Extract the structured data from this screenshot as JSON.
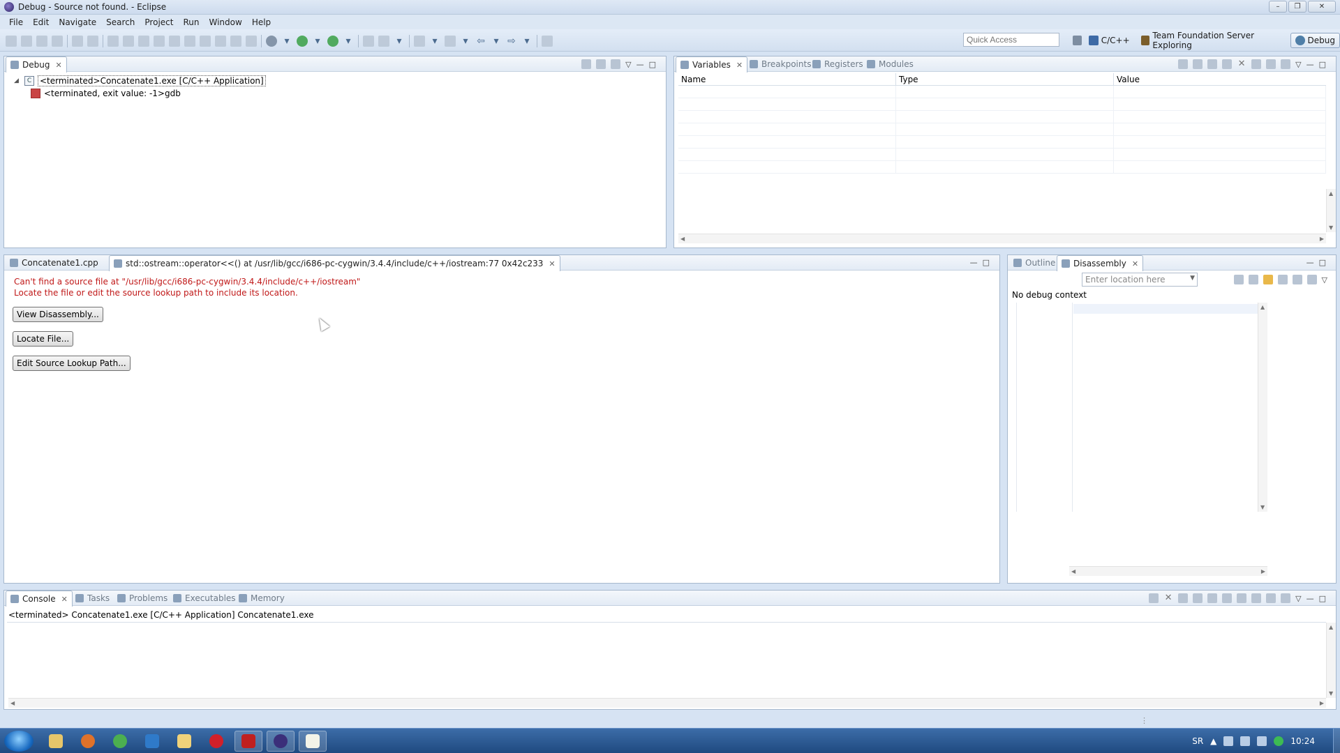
{
  "window": {
    "title": "Debug - Source not found. - Eclipse"
  },
  "menu": [
    "File",
    "Edit",
    "Navigate",
    "Search",
    "Project",
    "Run",
    "Window",
    "Help"
  ],
  "toolbar": {
    "quick_access_placeholder": "Quick Access"
  },
  "perspectives": [
    {
      "label": "C/C++",
      "icon": "cpp-perspective-icon"
    },
    {
      "label": "Team Foundation Server Exploring",
      "icon": "tfs-icon"
    },
    {
      "label": "Debug",
      "icon": "debug-icon",
      "active": true
    }
  ],
  "debug_view": {
    "tab": "Debug",
    "tree": [
      {
        "label": "<terminated>Concatenate1.exe [C/C++ Application]",
        "expanded": true
      },
      {
        "label": "<terminated, exit value: -1>gdb"
      }
    ]
  },
  "variables_view": {
    "tabs": [
      "Variables",
      "Breakpoints",
      "Registers",
      "Modules"
    ],
    "columns": [
      "Name",
      "Type",
      "Value"
    ]
  },
  "editor": {
    "tabs": [
      "Concatenate1.cpp",
      "std::ostream::operator<<() at /usr/lib/gcc/i686-pc-cygwin/3.4.4/include/c++/iostream:77 0x42c233"
    ],
    "error_line1": "Can't find a source file at \"/usr/lib/gcc/i686-pc-cygwin/3.4.4/include/c++/iostream\"",
    "error_line2": "Locate the file or edit the source lookup path to include its location.",
    "buttons": {
      "view_disassembly": "View Disassembly...",
      "locate_file": "Locate File...",
      "edit_source_lookup": "Edit Source Lookup Path..."
    }
  },
  "disassembly_view": {
    "tabs": [
      "Outline",
      "Disassembly"
    ],
    "location_placeholder": "Enter location here",
    "status": "No debug context"
  },
  "console_view": {
    "tabs": [
      "Console",
      "Tasks",
      "Problems",
      "Executables",
      "Memory"
    ],
    "text": "<terminated> Concatenate1.exe [C/C++ Application] Concatenate1.exe"
  },
  "taskbar": {
    "language": "SR",
    "time": "10:24",
    "apps": [
      "explorer",
      "firefox",
      "chrome",
      "app",
      "folder",
      "opera",
      "acrobat",
      "eclipse",
      "notepad"
    ]
  }
}
